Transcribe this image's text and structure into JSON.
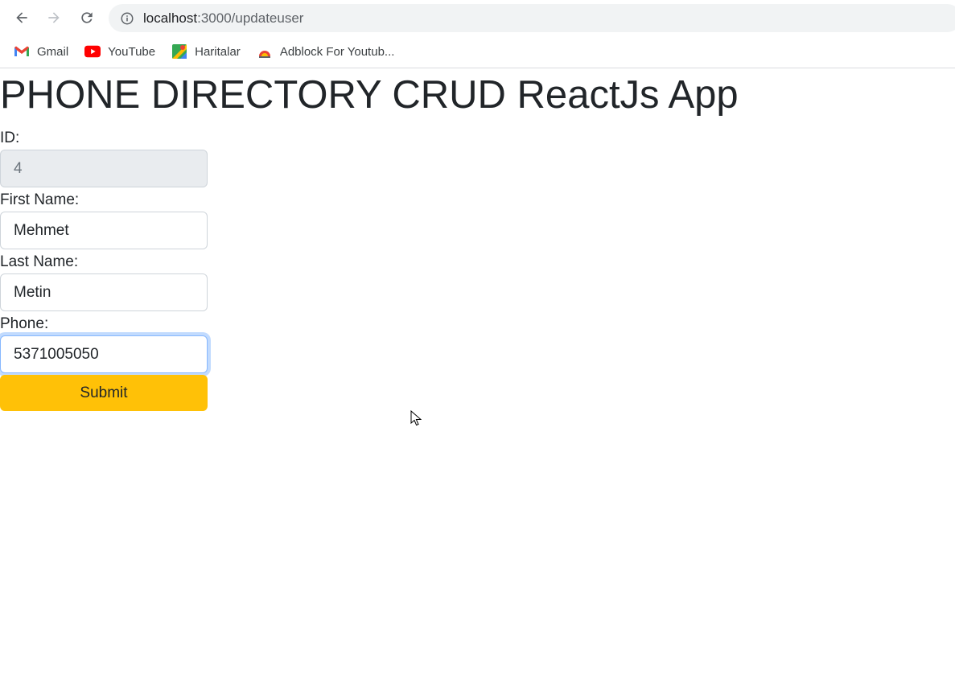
{
  "browser": {
    "url_host": "localhost",
    "url_path": ":3000/updateuser",
    "icons": {
      "back": "arrow-left-icon",
      "forward": "arrow-right-icon",
      "reload": "reload-icon",
      "info": "info-icon"
    },
    "bookmarks": [
      {
        "label": "Gmail",
        "icon": "gmail-icon"
      },
      {
        "label": "YouTube",
        "icon": "youtube-icon"
      },
      {
        "label": "Haritalar",
        "icon": "maps-icon"
      },
      {
        "label": "Adblock For Youtub...",
        "icon": "adblock-icon"
      }
    ]
  },
  "page": {
    "title": "PHONE DIRECTORY CRUD ReactJs App",
    "form": {
      "id_label": "ID:",
      "id_value": "4",
      "first_name_label": "First Name:",
      "first_name_value": "Mehmet",
      "last_name_label": "Last Name:",
      "last_name_value": "Metin",
      "phone_label": "Phone:",
      "phone_value": "5371005050",
      "submit_label": "Submit"
    }
  },
  "colors": {
    "submit_bg": "#ffc107",
    "disabled_bg": "#e9ecef",
    "focus_border": "#86b7fe",
    "text": "#212529"
  }
}
